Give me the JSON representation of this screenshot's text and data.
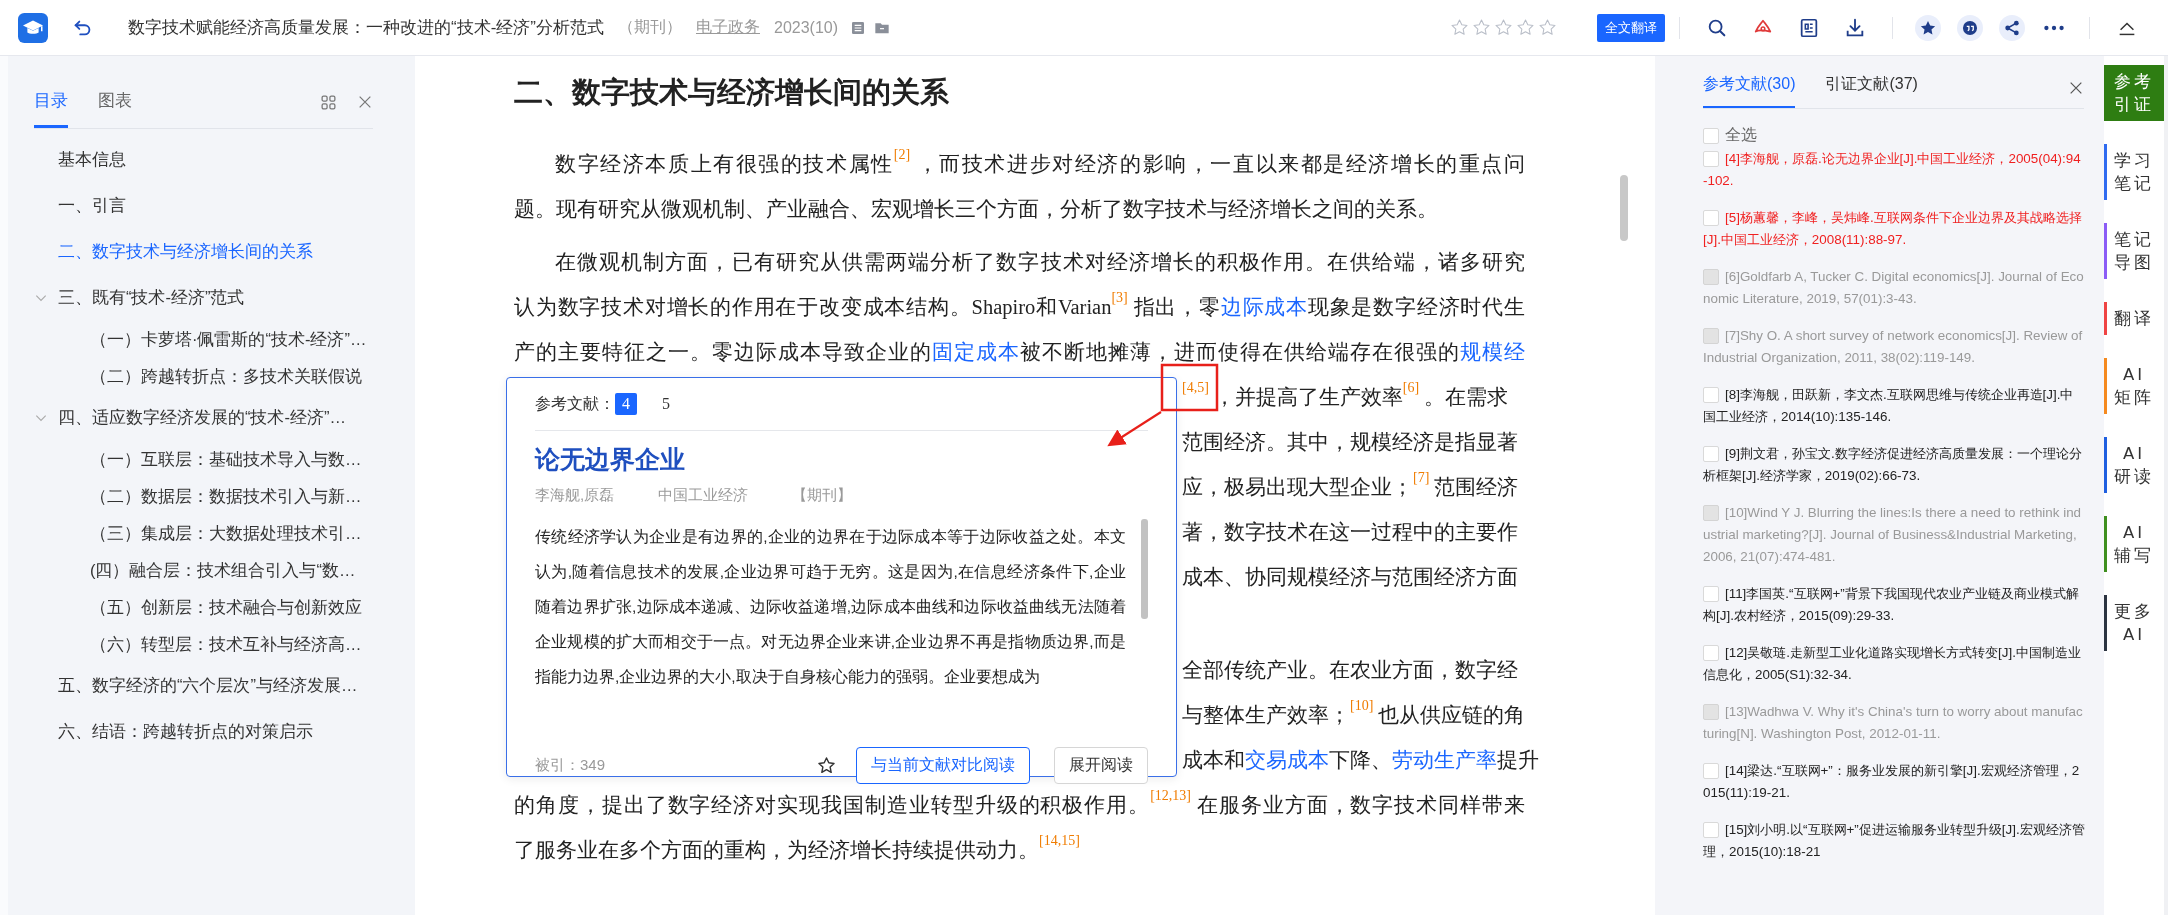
{
  "header": {
    "title": "数字技术赋能经济高质量发展：一种改进的“技术-经济”分析范式",
    "type": "（期刊）",
    "journal": "电子政务",
    "issue": "2023(10)",
    "stars": 0,
    "translate_button": "全文翻译"
  },
  "toc": {
    "tabs": [
      {
        "label": "目录",
        "selected": true
      },
      {
        "label": "图表",
        "selected": false
      }
    ],
    "items": [
      {
        "label": "基本信息",
        "selected": false
      },
      {
        "label": "一、引言",
        "selected": false
      },
      {
        "label": "二、数字技术与经济增长间的关系",
        "selected": true
      },
      {
        "label": "三、既有“技术-经济”范式",
        "selected": false,
        "expanded": true,
        "children": [
          {
            "label": "（一）卡萝塔·佩雷斯的“技术-经济”…",
            "selected": false
          },
          {
            "label": "（二）跨越转折点：多技术关联假说",
            "selected": false
          }
        ]
      },
      {
        "label": "四、适应数字经济发展的“技术-经济”…",
        "selected": false,
        "expanded": true,
        "children": [
          {
            "label": "（一）互联层：基础技术导入与数…",
            "selected": false
          },
          {
            "label": "（二）数据层：数据技术引入与新…",
            "selected": false
          },
          {
            "label": "（三）集成层：大数据处理技术引…",
            "selected": false
          },
          {
            "label": "(四）融合层：技术组合引入与“数…",
            "selected": false
          },
          {
            "label": "（五）创新层：技术融合与创新效应",
            "selected": false
          },
          {
            "label": "（六）转型层：技术互补与经济高…",
            "selected": false
          }
        ]
      },
      {
        "label": "五、数字经济的“六个层次”与经济发展…",
        "selected": false
      },
      {
        "label": "六、结语：跨越转折点的对策启示",
        "selected": false
      }
    ]
  },
  "article": {
    "heading": "二、数字技术与经济增长间的关系",
    "paragraphs": [
      {
        "lines": [
          {
            "kind": "first",
            "segments": [
              {
                "kind": "text",
                "text": "数字经济本质上有很强的技术属性"
              },
              {
                "kind": "cite",
                "text": "[2]"
              },
              {
                "kind": "text",
                "text": "，而技术进步对经济的影响，一直以来都是经济增长的重点问"
              }
            ]
          },
          {
            "kind": "end",
            "segments": [
              {
                "kind": "text",
                "text": "题。现有研究从微观机制、产业融合、宏观增长三个方面，分析了数字技术与经济增长之间的关系。"
              }
            ]
          }
        ]
      },
      {
        "lines": [
          {
            "kind": "first",
            "segments": [
              {
                "kind": "text",
                "text": "在微观机制方面，已有研究从供需两端分析了数字技术对经济增长的积极作用。在供给端，诸多研究"
              }
            ]
          },
          {
            "kind": "justified",
            "segments": [
              {
                "kind": "text",
                "text": "认为数字技术对增长的作用在于改变成本结构。Shapiro和Varian"
              },
              {
                "kind": "cite",
                "text": "[3]"
              },
              {
                "kind": "text",
                "text": "指出，零"
              },
              {
                "kind": "link",
                "text": "边际成本"
              },
              {
                "kind": "text",
                "text": "现象是数字经济时代生"
              }
            ]
          },
          {
            "kind": "justified",
            "segments": [
              {
                "kind": "text",
                "text": "产的主要特征之一。零边际成本导致企业的"
              },
              {
                "kind": "link",
                "text": "固定成本"
              },
              {
                "kind": "text",
                "text": "被不断地摊薄，进而使得在供给端存在很强的"
              },
              {
                "kind": "link",
                "text": "规模经"
              }
            ]
          },
          {
            "kind": "covered",
            "segments": [
              {
                "kind": "cite",
                "text": "[4,5]"
              },
              {
                "kind": "text",
                "text": "，并提高了生产效率"
              },
              {
                "kind": "cite",
                "text": "[6]"
              },
              {
                "kind": "text",
                "text": "。在需求"
              }
            ]
          },
          {
            "kind": "covered",
            "segments": [
              {
                "kind": "text",
                "text": "范围经济。其中，规模经济是指显著"
              }
            ]
          },
          {
            "kind": "covered",
            "segments": [
              {
                "kind": "text",
                "text": "应，极易出现大型企业；"
              },
              {
                "kind": "cite",
                "text": "[7]"
              },
              {
                "kind": "text",
                "text": "范围经济"
              }
            ]
          },
          {
            "kind": "covered",
            "segments": [
              {
                "kind": "text",
                "text": "著，数字技术在这一过程中的主要作"
              }
            ]
          },
          {
            "kind": "covered",
            "segments": [
              {
                "kind": "text",
                "text": "成本、协同规模经济与范围经济方面"
              }
            ]
          }
        ]
      },
      {
        "lines": [
          {
            "kind": "covered",
            "segments": [
              {
                "kind": "text",
                "text": "全部传统产业。在农业方面，数字经"
              }
            ]
          },
          {
            "kind": "covered",
            "segments": [
              {
                "kind": "text",
                "text": "与整体生产效率；"
              },
              {
                "kind": "cite",
                "text": "[10]"
              },
              {
                "kind": "text",
                "text": "也从供应链的角"
              }
            ]
          },
          {
            "kind": "covered",
            "segments": [
              {
                "kind": "text",
                "text": "成本和"
              },
              {
                "kind": "link",
                "text": "交易成本"
              },
              {
                "kind": "text",
                "text": "下降、"
              },
              {
                "kind": "link",
                "text": "劳动生产率"
              },
              {
                "kind": "text",
                "text": "提升"
              }
            ]
          },
          {
            "kind": "justified",
            "segments": [
              {
                "kind": "text",
                "text": "的角度，提出了数字经济对实现我国制造业转型升级的积极作用。"
              },
              {
                "kind": "cite",
                "text": "[12,13]"
              },
              {
                "kind": "text",
                "text": "在服务业方面，数字技术同样带来"
              }
            ]
          },
          {
            "kind": "end",
            "segments": [
              {
                "kind": "text",
                "text": "了服务业在多个方面的重构，为经济增长持续提供动力。"
              },
              {
                "kind": "cite",
                "text": "[14,15]"
              }
            ]
          }
        ]
      }
    ]
  },
  "popup": {
    "label": "参考文献：",
    "tabs": [
      {
        "label": "4",
        "selected": true
      },
      {
        "label": "5",
        "selected": false
      }
    ],
    "title": "论无边界企业",
    "authors": "李海舰,原磊",
    "journal": "中国工业经济",
    "type": "【期刊】",
    "abstract": "传统经济学认为企业是有边界的,企业的边界在于边际成本等于边际收益之处。本文认为,随着信息技术的发展,企业边界可趋于无穷。这是因为,在信息经济条件下,企业随着边界扩张,边际成本递减、边际收益递增,边际成本曲线和边际收益曲线无法随着企业规模的扩大而相交于一点。对无边界企业来讲,企业边界不再是指物质边界,而是指能力边界,企业边界的大小,取决于自身核心能力的强弱。企业要想成为",
    "cited": "被引：349",
    "compare_button": "与当前文献对比阅读",
    "read_button": "展开阅读"
  },
  "references": {
    "tabs": [
      {
        "label": "参考文献(30)",
        "selected": true
      },
      {
        "label": "引证文献(37)",
        "selected": false
      }
    ],
    "select_all": {
      "label": "全选",
      "checked": false
    },
    "items": [
      {
        "text": "[4]李海舰，原磊.论无边界企业[J].中国工业经济，2005(04):94-102.",
        "checked": false,
        "highlighted": true,
        "disabled": false
      },
      {
        "text": "[5]杨蕙馨，李峰，吴炜峰.互联网条件下企业边界及其战略选择[J].中国工业经济，2008(11):88-97.",
        "checked": false,
        "highlighted": true,
        "disabled": false
      },
      {
        "text": "[6]Goldfarb A, Tucker C. Digital economics[J]. Journal of Economic Literature, 2019, 57(01):3-43.",
        "checked": false,
        "highlighted": false,
        "disabled": true
      },
      {
        "text": "[7]Shy O. A short survey of network economics[J]. Review of Industrial Organization, 2011, 38(02):119-149.",
        "checked": false,
        "highlighted": false,
        "disabled": true
      },
      {
        "text": "[8]李海舰，田跃新，李文杰.互联网思维与传统企业再造[J].中国工业经济，2014(10):135-146.",
        "checked": false,
        "highlighted": false,
        "disabled": false
      },
      {
        "text": "[9]荆文君，孙宝文.数字经济促进经济高质量发展：一个理论分析框架[J].经济学家，2019(02):66-73.",
        "checked": false,
        "highlighted": false,
        "disabled": false
      },
      {
        "text": "[10]Wind Y J. Blurring the lines:Is there a need to rethink industrial marketing?[J]. Journal of Business&Industrial Marketing, 2006, 21(07):474-481.",
        "checked": false,
        "highlighted": false,
        "disabled": true
      },
      {
        "text": "[11]李国英.“互联网+”背景下我国现代农业产业链及商业模式解构[J].农村经济，2015(09):29-33.",
        "checked": false,
        "highlighted": false,
        "disabled": false
      },
      {
        "text": "[12]吴敬琏.走新型工业化道路实现增长方式转变[J].中国制造业信息化，2005(S1):32-34.",
        "checked": false,
        "highlighted": false,
        "disabled": false
      },
      {
        "text": "[13]Wadhwa V. Why it's China's turn to worry about manufacturing[N]. Washington Post, 2012-01-11.",
        "checked": false,
        "highlighted": false,
        "disabled": true
      },
      {
        "text": "[14]梁达.“互联网+”：服务业发展的新引擎[J].宏观经济管理，2015(11):19-21.",
        "checked": false,
        "highlighted": false,
        "disabled": false
      },
      {
        "text": "[15]刘小明.以“互联网+”促进运输服务业转型升级[J].宏观经济管理，2015(10):18-21",
        "checked": false,
        "highlighted": false,
        "disabled": false
      }
    ]
  },
  "tools": [
    {
      "label": "参考引证",
      "color": "#2e7d12",
      "selected": true
    },
    {
      "label": "学习笔记",
      "color": "#2f6bf0",
      "selected": false
    },
    {
      "label": "笔记导图",
      "color": "#8b5cf6",
      "selected": false
    },
    {
      "label": "翻译",
      "color": "#ef4444",
      "selected": false
    },
    {
      "label": "AI矩阵",
      "color": "#f58a1f",
      "selected": false
    },
    {
      "label": "AI研读",
      "color": "#1f5fe0",
      "selected": false
    },
    {
      "label": "AI辅写",
      "color": "#3f8f1f",
      "selected": false
    },
    {
      "label": "更多AI",
      "color": "#2c3441",
      "selected": false
    }
  ]
}
